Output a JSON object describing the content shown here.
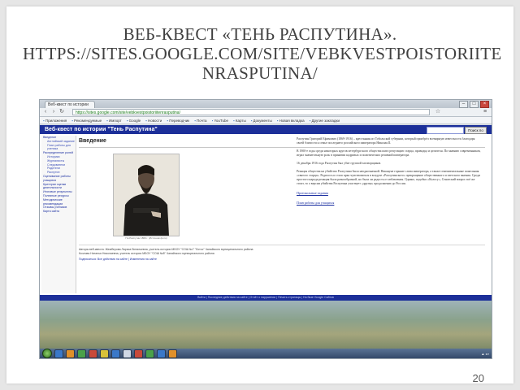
{
  "slide": {
    "title_line1": "ВЕБ-КВЕСТ «ТЕНЬ РАСПУТИНА».",
    "title_line2": "HTTPS://SITES.GOOGLE.COM/SITE/VEBKVESTPOISTORIITE",
    "title_line3": "NRASPUTINA/",
    "page_number": "20"
  },
  "browser": {
    "tab_title": "Веб-квест по истории",
    "address": "https://sites.google.com/site/vebkvestpoistoriitenrasputina/",
    "bookmarks": [
      "Приложения",
      "Рекомендуемые",
      "Импорт",
      "Google",
      "Новости",
      "Переводчик",
      "Почта",
      "YouTube",
      "Карты",
      "Документы",
      "Новая вкладка",
      "Другие закладки"
    ]
  },
  "site": {
    "header_title": "Веб-квест по истории \"Тень Распутина\"",
    "search_button": "Поиск по сайту",
    "section_title": "Введение",
    "sidebar": [
      {
        "label": "Введение",
        "sub": false
      },
      {
        "label": "Английский задание",
        "sub": true
      },
      {
        "label": "План работы для ученика",
        "sub": true
      },
      {
        "label": "Распределение ролей",
        "sub": false
      },
      {
        "label": "Историки",
        "sub": true
      },
      {
        "label": "Журналисты",
        "sub": true
      },
      {
        "label": "Следователи",
        "sub": true
      },
      {
        "label": "Родители",
        "sub": true
      },
      {
        "label": "Распутин",
        "sub": true
      },
      {
        "label": "Оценивание работы учащихся",
        "sub": false
      },
      {
        "label": "Критерии оценки деятельности",
        "sub": false
      },
      {
        "label": "Итоговые результаты",
        "sub": false
      },
      {
        "label": "Полезные ресурсы",
        "sub": false
      },
      {
        "label": "Методические рекомендации",
        "sub": false
      },
      {
        "label": "Отзывы учеников",
        "sub": false
      },
      {
        "label": "Карта сайта",
        "sub": false
      }
    ],
    "photo_caption": "Г.Е.Распутин 1869 г. (Источник фото)",
    "paragraphs": [
      "Распутин Григорий Ефимович (1869-1916) – крестьянин из Тобольской губернии, который приобрёл всемирную известность благодаря своей близости к семье последнего российского императора Николая II.",
      "В 1900-е годы среди некоторых кругов петербургского общества имел репутацию старца, провидца и целителя. По мнению современников, играл значительную роль в принятии кадровых и политических решений императора.",
      "16 декабря 1916 года Распутин был убит группой заговорщиков.",
      "Реакция общества на убийство Распутина была неоднозначной. Накануне горькие слова императора, а также сентиментальные пожелания «святого старца». Родилось и стало ярко чувствоваться в воздухе «Распутинского» прекращение общественного и светского мнения. Среди простого народа реакция была разнообразной, но была ли радость от избавления. Однако, подобно «Колосу», Сенатский вопрос всё же стоит, то о версии убийства Распутина участвует «друзья» продолжение до России."
    ],
    "links": [
      "Протокольные задания",
      "План работы для учащихся"
    ],
    "authors_line1": "Авторы веб-квеста: Жемберова Лариса Витальевна, учитель истории МБОУ \"СОШ №7 \"Лотос\" Чапайского муниципального района",
    "authors_line2": "Козлова Наталья Николаевна, учитель истории МБОУ \"СОШ №8\" Чапайского муниципального района",
    "subscribe": "Подписаться: Все действия на сайте | Изменения на сайте",
    "footer": "Войти | Последние действия на сайте | Отчёт о нарушении | Печать страницы | На базе Google Сайтов"
  }
}
